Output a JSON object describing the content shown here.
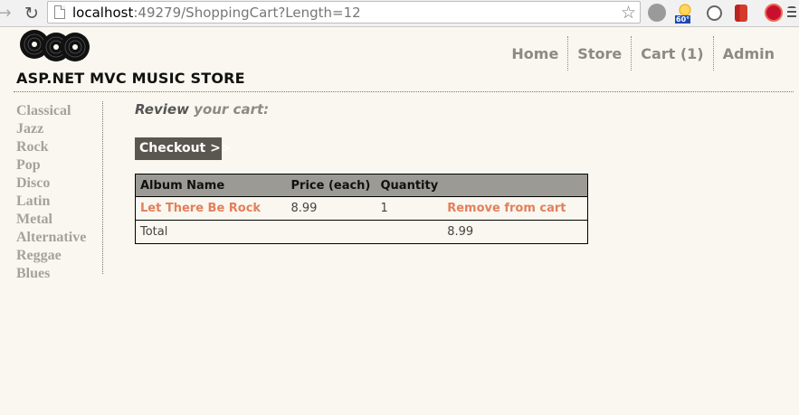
{
  "browser": {
    "url_host": "localhost",
    "url_rest": ":49279/ShoppingCart?Length=12",
    "weather_temp": "60°"
  },
  "site": {
    "title": "ASP.NET MVC MUSIC STORE"
  },
  "top_nav": [
    {
      "label": "Home"
    },
    {
      "label": "Store"
    },
    {
      "label": "Cart (1)"
    },
    {
      "label": "Admin"
    }
  ],
  "genres": [
    "Classical",
    "Jazz",
    "Rock",
    "Pop",
    "Disco",
    "Latin",
    "Metal",
    "Alternative",
    "Reggae",
    "Blues"
  ],
  "main": {
    "review_bold": "Review",
    "review_light": "your cart:",
    "checkout_label": "Checkout >>"
  },
  "cart": {
    "headers": [
      "Album Name",
      "Price (each)",
      "Quantity",
      ""
    ],
    "items": [
      {
        "album": "Let There Be Rock",
        "price": "8.99",
        "quantity": "1",
        "remove": "Remove from cart"
      }
    ],
    "total_label": "Total",
    "total_value": "8.99"
  },
  "colors": {
    "background": "#f9f7ef",
    "link": "#e37f5c",
    "nav": "#8d8a80",
    "table_header": "#9b9a94",
    "checkout_button": "#5a5750"
  }
}
